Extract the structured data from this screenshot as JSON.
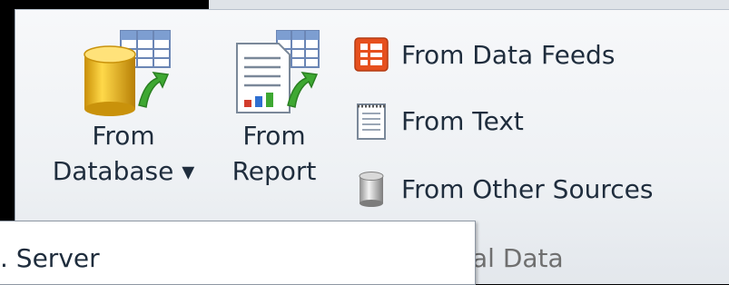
{
  "ribbon": {
    "group_label": "al Data",
    "from_database": {
      "line1": "From",
      "line2": "Database ▾"
    },
    "from_report": {
      "line1": "From",
      "line2": "Report"
    },
    "small_buttons": [
      {
        "label": "From Data Feeds",
        "icon": "data-feed-icon"
      },
      {
        "label": "From Text",
        "icon": "text-file-icon"
      },
      {
        "label": "From Other Sources",
        "icon": "cylinder-icon"
      }
    ]
  },
  "dropdown": {
    "items": [
      {
        "label": ". Server"
      }
    ]
  }
}
